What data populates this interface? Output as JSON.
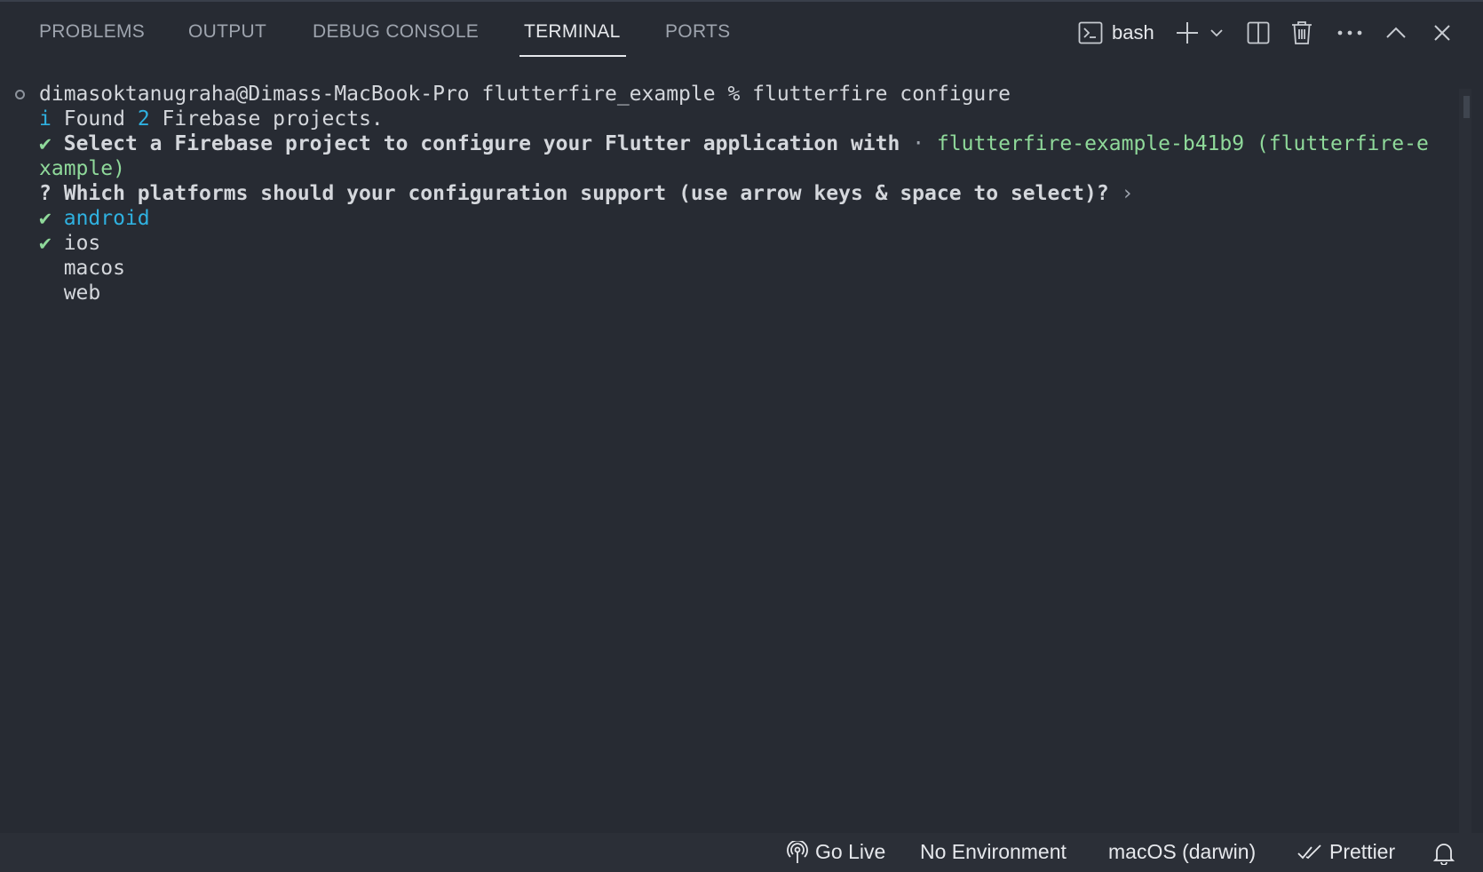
{
  "tabs": [
    {
      "label": "PROBLEMS",
      "active": false
    },
    {
      "label": "OUTPUT",
      "active": false
    },
    {
      "label": "DEBUG CONSOLE",
      "active": false
    },
    {
      "label": "TERMINAL",
      "active": true
    },
    {
      "label": "PORTS",
      "active": false
    }
  ],
  "toolbar": {
    "shell_label": "bash",
    "icons": [
      "terminal-icon",
      "plus-icon",
      "chevron-down-icon",
      "split-icon",
      "trash-icon",
      "ellipsis-icon",
      "chevron-up-icon",
      "close-icon"
    ]
  },
  "terminal": {
    "prompt": "dimasoktanugraha@Dimass-MacBook-Pro flutterfire_example % flutterfire configure",
    "found_prefix": "i",
    "found_a": "Found ",
    "found_count": "2",
    "found_b": " Firebase projects.",
    "select_check": "✔",
    "select_text": "Select a Firebase project to configure your Flutter application with",
    "select_sep": "·",
    "select_value_line1": "flutterfire-example-b41b9 (flutterfire-e",
    "select_value_line2": "xample)",
    "question_mark": "?",
    "question_text": "Which platforms should your configuration support (use arrow keys & space to select)?",
    "question_arrow": "›",
    "options": [
      {
        "label": "android",
        "selected": true,
        "focused": true
      },
      {
        "label": "ios",
        "selected": true,
        "focused": false
      },
      {
        "label": "macos",
        "selected": false,
        "focused": false
      },
      {
        "label": "web",
        "selected": false,
        "focused": false
      }
    ],
    "check_glyph": "✔"
  },
  "statusbar": {
    "go_live": "Go Live",
    "environment": "No Environment",
    "os": "macOS (darwin)",
    "prettier": "Prettier"
  },
  "colors": {
    "background": "#272b33",
    "green": "#8fd99a",
    "cyan": "#2fb1e0"
  }
}
